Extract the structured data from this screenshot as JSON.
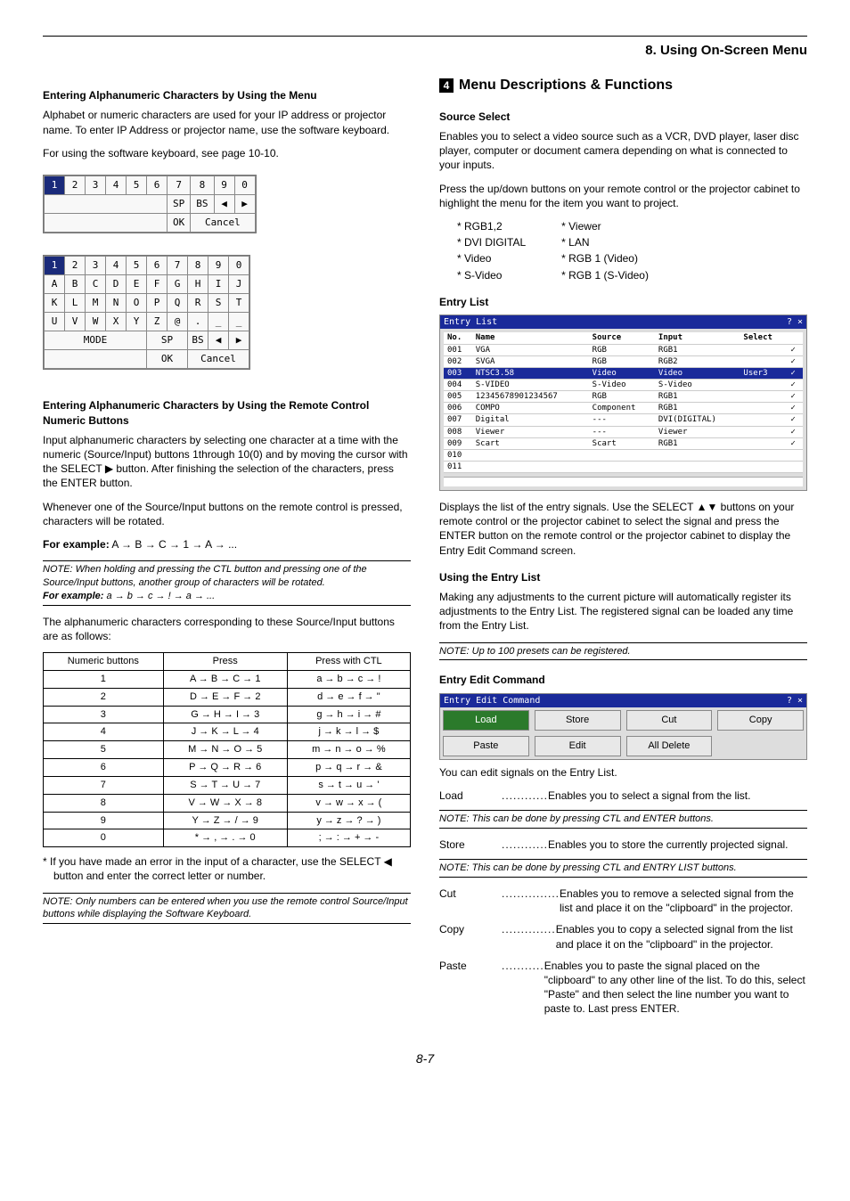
{
  "header": {
    "section": "8. Using On-Screen Menu"
  },
  "left": {
    "h1": "Entering Alphanumeric Characters by Using the Menu",
    "p1": "Alphabet or numeric characters are used for your IP address or projector name. To enter IP Address or projector name, use the software keyboard.",
    "p2": "For using the software keyboard, see page 10-10.",
    "kb1": {
      "row1": [
        "1",
        "2",
        "3",
        "4",
        "5",
        "6",
        "7",
        "8",
        "9",
        "0"
      ],
      "sp": "SP",
      "bs": "BS",
      "ok": "OK",
      "cancel": "Cancel"
    },
    "kb2": {
      "row1": [
        "1",
        "2",
        "3",
        "4",
        "5",
        "6",
        "7",
        "8",
        "9",
        "0"
      ],
      "row2": [
        "A",
        "B",
        "C",
        "D",
        "E",
        "F",
        "G",
        "H",
        "I",
        "J"
      ],
      "row3": [
        "K",
        "L",
        "M",
        "N",
        "O",
        "P",
        "Q",
        "R",
        "S",
        "T"
      ],
      "row4": [
        "U",
        "V",
        "W",
        "X",
        "Y",
        "Z",
        "@",
        ".",
        "_",
        "_"
      ],
      "mode": "MODE",
      "sp": "SP",
      "bs": "BS",
      "ok": "OK",
      "cancel": "Cancel"
    },
    "h2": "Entering Alphanumeric Characters by Using the Remote Control Numeric Buttons",
    "p3": "Input alphanumeric characters by selecting one character at a time with the numeric (Source/Input) buttons 1through 10(0) and by moving the cursor with the SELECT ▶ button. After finishing the selection of the characters, press the ENTER button.",
    "p4": "Whenever one of the Source/Input buttons on the remote control is pressed, characters will be rotated.",
    "ex_label": "For example:",
    "ex_text": " A → B → C → 1 → A → ...",
    "note1a": "NOTE: When holding and pressing the CTL button and pressing one of the Source/Input buttons, another group of characters will be rotated.",
    "note1b_label": "For example:",
    "note1b_text": " a → b → c → ! → a → ...",
    "p5": "The alphanumeric characters corresponding to these Source/Input buttons are as follows:",
    "table": {
      "head": [
        "Numeric buttons",
        "Press",
        "Press with CTL"
      ],
      "rows": [
        [
          "1",
          "A → B → C → 1",
          "a → b → c → !"
        ],
        [
          "2",
          "D → E → F → 2",
          "d → e → f → \""
        ],
        [
          "3",
          "G → H → I → 3",
          "g → h → i → #"
        ],
        [
          "4",
          "J → K → L → 4",
          "j → k → l → $"
        ],
        [
          "5",
          "M → N → O → 5",
          "m → n → o → %"
        ],
        [
          "6",
          "P → Q → R → 6",
          "p → q → r → &"
        ],
        [
          "7",
          "S → T → U → 7",
          "s → t → u → '"
        ],
        [
          "8",
          "V → W → X → 8",
          "v → w → x → ("
        ],
        [
          "9",
          "Y → Z → / → 9",
          "y → z → ? → )"
        ],
        [
          "0",
          "* → , →  . → 0",
          "; → : → + → -"
        ]
      ]
    },
    "p6": "*   If you have made an error in the input of a character, use the SELECT ◀ button and enter the correct letter or number.",
    "note2": "NOTE: Only numbers can be entered when you use the remote control Source/Input buttons while displaying the Software Keyboard."
  },
  "right": {
    "bignum": "4",
    "bigtitle": "Menu Descriptions & Functions",
    "h_src": "Source Select",
    "p_src1": "Enables you to select a video source such as a VCR, DVD player, laser disc player, computer or document camera depending on what is connected to your inputs.",
    "p_src2": "Press the up/down buttons on your remote control or the projector cabinet to highlight the menu for the item you want to project.",
    "srcL": [
      "* RGB1,2",
      "* DVI DIGITAL",
      "* Video",
      "* S-Video"
    ],
    "srcR": [
      "* Viewer",
      "* LAN",
      "* RGB 1 (Video)",
      "* RGB 1 (S-Video)"
    ],
    "h_entry": "Entry List",
    "entry_title": "Entry List",
    "entry_head": [
      "No.",
      "Name",
      "Source",
      "Input",
      "Select",
      ""
    ],
    "entry_rows": [
      [
        "001",
        "VGA",
        "RGB",
        "RGB1",
        "",
        "✓"
      ],
      [
        "002",
        "SVGA",
        "RGB",
        "RGB2",
        "",
        "✓"
      ],
      [
        "003",
        "NTSC3.58",
        "Video",
        "Video",
        "User3",
        "✓"
      ],
      [
        "004",
        "S-VIDEO",
        "S-Video",
        "S-Video",
        "",
        "✓"
      ],
      [
        "005",
        "12345678901234567",
        "RGB",
        "RGB1",
        "",
        "✓"
      ],
      [
        "006",
        "COMPO",
        "Component",
        "RGB1",
        "",
        "✓"
      ],
      [
        "007",
        "Digital",
        "---",
        "DVI(DIGITAL)",
        "",
        "✓"
      ],
      [
        "008",
        "Viewer",
        "---",
        "Viewer",
        "",
        "✓"
      ],
      [
        "009",
        "Scart",
        "Scart",
        "RGB1",
        "",
        "✓"
      ],
      [
        "010",
        "",
        "",
        "",
        "",
        ""
      ],
      [
        "011",
        "",
        "",
        "",
        "",
        ""
      ]
    ],
    "p_entry": "Displays the list of the entry signals. Use the SELECT ▲▼ buttons on your remote control or the projector cabinet to select the signal and press the ENTER button on the remote control or the projector cabinet to display the Entry Edit Command screen.",
    "h_use": "Using the Entry List",
    "p_use": "Making any adjustments to the current picture will automatically register its adjustments to the Entry List. The registered signal can be loaded any time from the Entry List.",
    "note_use": "NOTE: Up to 100 presets can be registered.",
    "h_cmd": "Entry Edit Command",
    "cmd_title": "Entry Edit Command",
    "cmd_btns": [
      "Load",
      "Store",
      "Cut",
      "Copy",
      "Paste",
      "Edit",
      "All Delete",
      ""
    ],
    "p_cmd": "You can edit signals on the Entry List.",
    "dlist": [
      {
        "term": "Load",
        "dots": " ............",
        "desc": "Enables you to select a signal from the list."
      },
      {
        "note": "NOTE: This can be done by pressing CTL and ENTER buttons."
      },
      {
        "term": "Store",
        "dots": " ............",
        "desc": "Enables you to store the currently projected signal."
      },
      {
        "note": "NOTE: This can be done by pressing CTL and ENTRY LIST buttons."
      },
      {
        "term": "Cut",
        "dots": " ...............",
        "desc": "Enables you to remove a selected signal from the list and place it on the \"clipboard\" in the projector."
      },
      {
        "term": "Copy",
        "dots": " ..............",
        "desc": "Enables you to copy a selected signal from the list and place it on the \"clipboard\" in the projector."
      },
      {
        "term": "Paste",
        "dots": " ...........",
        "desc": "Enables you to paste the signal placed on the \"clipboard\" to any other line of the list. To do this, select \"Paste\" and then select the line number you want to paste to. Last press ENTER."
      }
    ]
  },
  "page": "8-7"
}
